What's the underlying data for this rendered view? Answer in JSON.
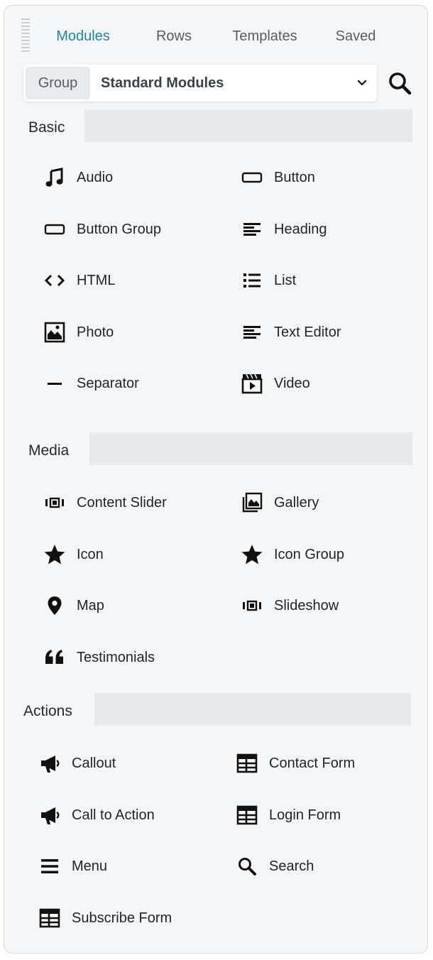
{
  "tabs": [
    {
      "label": "Modules",
      "active": true
    },
    {
      "label": "Rows"
    },
    {
      "label": "Templates"
    },
    {
      "label": "Saved"
    }
  ],
  "group": {
    "label": "Group",
    "value": "Standard Modules"
  },
  "sections": [
    {
      "title": "Basic",
      "modules": [
        {
          "label": "Audio",
          "icon": "music-note-icon"
        },
        {
          "label": "Button",
          "icon": "button-outline-icon"
        },
        {
          "label": "Button Group",
          "icon": "button-outline-icon"
        },
        {
          "label": "Heading",
          "icon": "text-lines-icon"
        },
        {
          "label": "HTML",
          "icon": "code-icon"
        },
        {
          "label": "List",
          "icon": "list-icon"
        },
        {
          "label": "Photo",
          "icon": "photo-icon"
        },
        {
          "label": "Text Editor",
          "icon": "text-lines-icon"
        },
        {
          "label": "Separator",
          "icon": "minus-icon"
        },
        {
          "label": "Video",
          "icon": "video-clapper-icon"
        }
      ]
    },
    {
      "title": "Media",
      "modules": [
        {
          "label": "Content Slider",
          "icon": "slider-icon"
        },
        {
          "label": "Gallery",
          "icon": "gallery-icon"
        },
        {
          "label": "Icon",
          "icon": "star-icon"
        },
        {
          "label": "Icon Group",
          "icon": "star-icon"
        },
        {
          "label": "Map",
          "icon": "map-pin-icon"
        },
        {
          "label": "Slideshow",
          "icon": "slider-icon"
        },
        {
          "label": "Testimonials",
          "icon": "quote-icon"
        }
      ]
    },
    {
      "title": "Actions",
      "modules": [
        {
          "label": "Callout",
          "icon": "megaphone-icon"
        },
        {
          "label": "Contact Form",
          "icon": "form-table-icon"
        },
        {
          "label": "Call to Action",
          "icon": "megaphone-icon"
        },
        {
          "label": "Login Form",
          "icon": "form-table-icon"
        },
        {
          "label": "Menu",
          "icon": "hamburger-menu-icon"
        },
        {
          "label": "Search",
          "icon": "search-icon"
        },
        {
          "label": "Subscribe Form",
          "icon": "form-table-icon"
        }
      ]
    }
  ]
}
